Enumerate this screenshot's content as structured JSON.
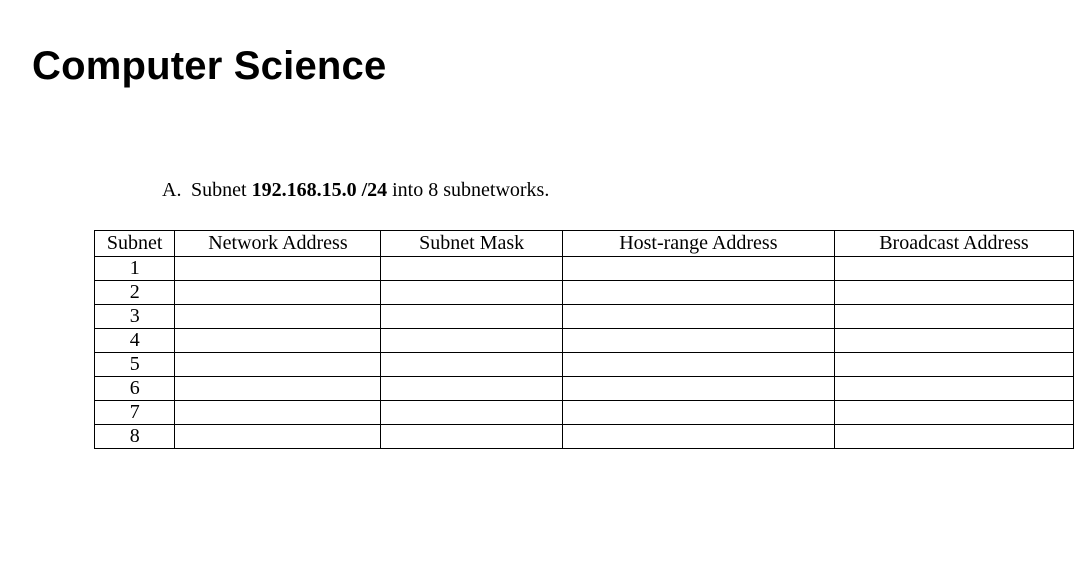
{
  "title": "Computer Science",
  "question": {
    "letter": "A.",
    "prefix": "Subnet ",
    "bold": "192.168.15.0 /24",
    "suffix": " into 8 subnetworks."
  },
  "table": {
    "headers": {
      "subnet": "Subnet",
      "network": "Network Address",
      "mask": "Subnet Mask",
      "hostrange": "Host-range Address",
      "broadcast": "Broadcast Address"
    },
    "rows": [
      {
        "subnet": "1",
        "network": "",
        "mask": "",
        "hostrange": "",
        "broadcast": ""
      },
      {
        "subnet": "2",
        "network": "",
        "mask": "",
        "hostrange": "",
        "broadcast": ""
      },
      {
        "subnet": "3",
        "network": "",
        "mask": "",
        "hostrange": "",
        "broadcast": ""
      },
      {
        "subnet": "4",
        "network": "",
        "mask": "",
        "hostrange": "",
        "broadcast": ""
      },
      {
        "subnet": "5",
        "network": "",
        "mask": "",
        "hostrange": "",
        "broadcast": ""
      },
      {
        "subnet": "6",
        "network": "",
        "mask": "",
        "hostrange": "",
        "broadcast": ""
      },
      {
        "subnet": "7",
        "network": "",
        "mask": "",
        "hostrange": "",
        "broadcast": ""
      },
      {
        "subnet": "8",
        "network": "",
        "mask": "",
        "hostrange": "",
        "broadcast": ""
      }
    ]
  }
}
